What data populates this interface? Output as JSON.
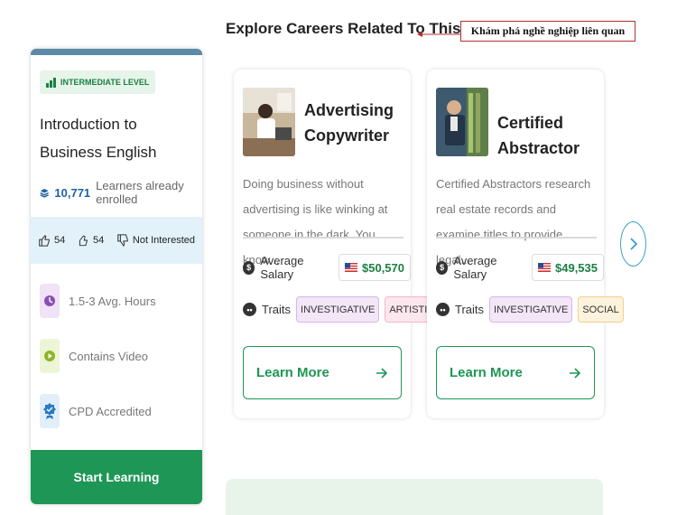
{
  "course": {
    "level": "INTERMEDIATE LEVEL",
    "title": "Introduction to Business English",
    "learners_count": "10,771",
    "learners_label": "Learners already enrolled",
    "likes": "54",
    "thumbs": "54",
    "not_interested": "Not Interested",
    "features": [
      {
        "label": "1.5-3 Avg. Hours",
        "icon": "clock-icon"
      },
      {
        "label": "Contains Video",
        "icon": "play-icon"
      },
      {
        "label": "CPD Accredited",
        "icon": "badge-icon"
      }
    ],
    "start_button": "Start Learning"
  },
  "section": {
    "title": "Explore Careers Related To This Course",
    "annotation": "Khám phá nghề nghiệp liên quan"
  },
  "careers": [
    {
      "title": "Advertising Copywriter",
      "description": "Doing business without advertising is like winking at someone in the dark. You know...",
      "salary_label": "Average Salary",
      "salary": "$50,570",
      "traits_label": "Traits",
      "traits": [
        "INVESTIGATIVE",
        "ARTISTIC"
      ],
      "button": "Learn More"
    },
    {
      "title": "Certified Abstractor",
      "description": "Certified Abstractors research real estate records and examine titles to provide legal...",
      "salary_label": "Average Salary",
      "salary": "$49,535",
      "traits_label": "Traits",
      "traits": [
        "INVESTIGATIVE",
        "SOCIAL"
      ],
      "button": "Learn More"
    }
  ],
  "colors": {
    "accent": "#1e9656",
    "link": "#1f5fa8",
    "annotation_border": "#b53030"
  }
}
